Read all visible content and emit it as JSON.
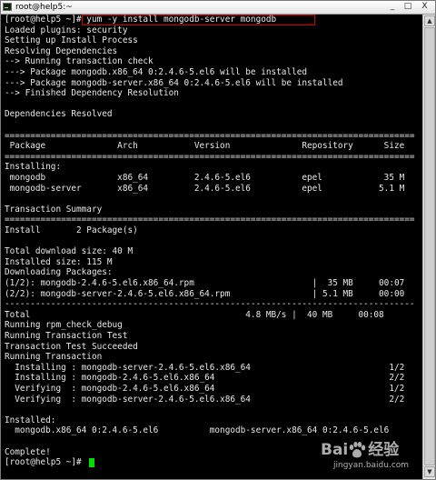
{
  "window": {
    "title": "root@help5:~",
    "controls": {
      "minimize": "_",
      "maximize": "□",
      "close": "X"
    }
  },
  "terminal": {
    "lines": [
      "[root@help5 ~]# yum -y install mongodb-server mongodb",
      "Loaded plugins: security",
      "Setting up Install Process",
      "Resolving Dependencies",
      "--> Running transaction check",
      "---> Package mongodb.x86_64 0:2.4.6-5.el6 will be installed",
      "---> Package mongodb-server.x86_64 0:2.4.6-5.el6 will be installed",
      "--> Finished Dependency Resolution",
      "",
      "Dependencies Resolved",
      "",
      "================================================================================",
      " Package              Arch           Version              Repository      Size",
      "================================================================================",
      "Installing:",
      " mongodb              x86_64         2.4.6-5.el6          epel            35 M",
      " mongodb-server       x86_64         2.4.6-5.el6          epel           5.1 M",
      "",
      "Transaction Summary",
      "================================================================================",
      "Install       2 Package(s)",
      "",
      "Total download size: 40 M",
      "Installed size: 115 M",
      "Downloading Packages:",
      "(1/2): mongodb-2.4.6-5.el6.x86_64.rpm                       |  35 MB     00:07",
      "(2/2): mongodb-server-2.4.6-5.el6.x86_64.rpm                | 5.1 MB     00:00",
      "--------------------------------------------------------------------------------",
      "Total                                          4.8 MB/s |  40 MB     00:08",
      "Running rpm_check_debug",
      "Running Transaction Test",
      "Transaction Test Succeeded",
      "Running Transaction",
      "  Installing : mongodb-server-2.4.6-5.el6.x86_64                           1/2",
      "  Installing : mongodb-2.4.6-5.el6.x86_64                                  2/2",
      "  Verifying  : mongodb-2.4.6-5.el6.x86_64                                  1/2",
      "  Verifying  : mongodb-server-2.4.6-5.el6.x86_64                           2/2",
      "",
      "Installed:",
      "  mongodb.x86_64 0:2.4.6-5.el6          mongodb-server.x86_64 0:2.4.6-5.el6",
      "",
      "Complete!",
      "[root@help5 ~]# "
    ]
  },
  "scrollbar": {
    "up_arrow": "▲",
    "down_arrow": "▼"
  },
  "watermark": {
    "logo_left": "Bai",
    "logo_right": "经验",
    "url": "jingyan.baidu.com"
  },
  "colors": {
    "background": "#000000",
    "text": "#e8e8e8",
    "cursor": "#00e000",
    "highlight_box": "#d60000"
  }
}
